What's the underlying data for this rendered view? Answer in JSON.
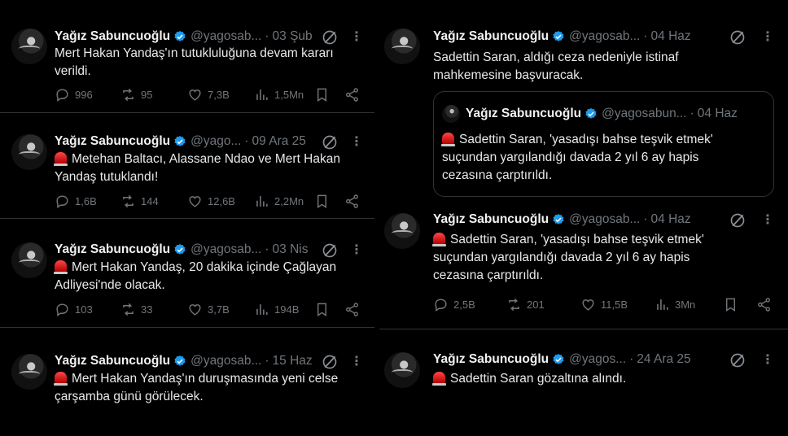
{
  "colors": {
    "background": "#000000",
    "text": "#e7e9ea",
    "muted": "#71767b",
    "verified": "#1d9bf0",
    "divider": "#2f3336",
    "siren": "#e0245e"
  },
  "icons": {
    "verified": "verified-badge-icon",
    "grok": "grok-icon",
    "more": "more-icon",
    "reply": "reply-icon",
    "retweet": "retweet-icon",
    "like": "like-icon",
    "views": "views-icon",
    "bookmark": "bookmark-icon",
    "share": "share-icon",
    "siren": "siren-emoji-icon"
  },
  "left": [
    {
      "name": "Yağız Sabuncuoğlu",
      "handle": "@yagosab...",
      "date": "03 Şub",
      "line1": "Mert Hakan Yandaş'ın tutukluluğuna devam kararı",
      "line2": "verildi.",
      "reply": "996",
      "retweet": "95",
      "like": "7,3B",
      "views": "1,5Mn"
    },
    {
      "name": "Yağız Sabuncuoğlu",
      "handle": "@yago...",
      "date": "09 Ara 25",
      "line1": "Metehan Baltacı, Alassane Ndao ve Mert Hakan",
      "line2": "Yandaş tutuklandı!",
      "reply": "1,6B",
      "retweet": "144",
      "like": "12,6B",
      "views": "2,2Mn"
    },
    {
      "name": "Yağız Sabuncuoğlu",
      "handle": "@yagosab...",
      "date": "03 Nis",
      "line1": "Mert Hakan Yandaş, 20 dakika içinde Çağlayan",
      "line2": "Adliyesi'nde olacak.",
      "reply": "103",
      "retweet": "33",
      "like": "3,7B",
      "views": "194B"
    },
    {
      "name": "Yağız Sabuncuoğlu",
      "handle": "@yagosab...",
      "date": "15 Haz",
      "line1": "Mert Hakan Yandaş'ın duruşmasında yeni celse",
      "line2": "çarşamba günü görülecek."
    }
  ],
  "right": {
    "t1": {
      "name": "Yağız Sabuncuoğlu",
      "handle": "@yagosab...",
      "date": "04 Haz",
      "line1": "Sadettin Saran, aldığı ceza nedeniyle istinaf",
      "line2": "mahkemesine başvuracak.",
      "quote": {
        "name": "Yağız Sabuncuoğlu",
        "handle": "@yagosabun...",
        "date": "04 Haz",
        "line1": "Sadettin Saran, 'yasadışı bahse teşvik etmek'",
        "line2": "suçundan yargılandığı davada 2 yıl 6 ay hapis",
        "line3": "cezasına çarptırıldı."
      }
    },
    "t2": {
      "name": "Yağız Sabuncuoğlu",
      "handle": "@yagosab...",
      "date": "04 Haz",
      "line1": "Sadettin Saran, 'yasadışı bahse teşvik etmek'",
      "line2": "suçundan yargılandığı davada 2 yıl 6 ay hapis",
      "line3": "cezasına çarptırıldı.",
      "reply": "2,5B",
      "retweet": "201",
      "like": "11,5B",
      "views": "3Mn"
    },
    "t3": {
      "name": "Yağız Sabuncuoğlu",
      "handle": "@yagos...",
      "date": "24 Ara 25",
      "line1": "Sadettin Saran gözaltına alındı."
    }
  }
}
